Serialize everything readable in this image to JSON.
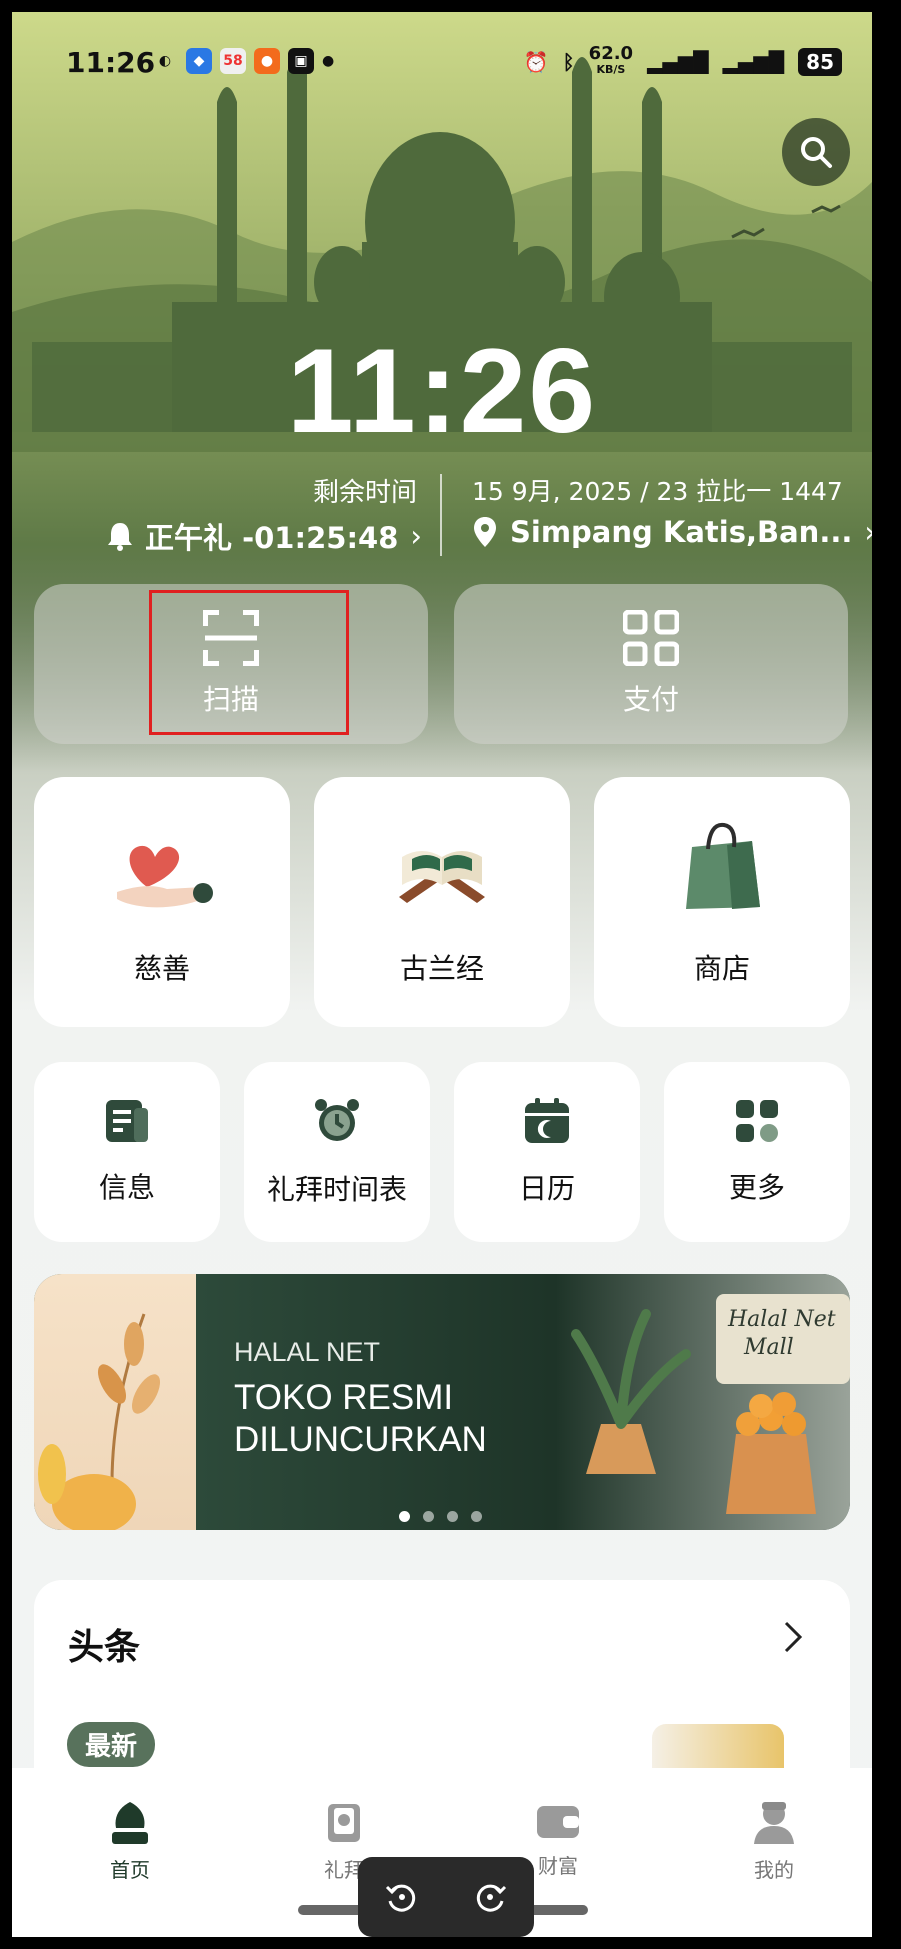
{
  "status_bar": {
    "time": "11:26",
    "apps": [
      "wechat",
      "map-app",
      "58",
      "video-app",
      "tv-app"
    ],
    "net_speed": "62.0",
    "net_unit": "KB/S",
    "battery": "85"
  },
  "hero": {
    "clock": "11:26",
    "remaining_label": "剩余时间",
    "prayer_name_countdown": "正午礼 -01:25:48",
    "date": "15 9月, 2025 / 23 拉比一 1447",
    "location": "Simpang Katis,Ban..."
  },
  "quick_actions": [
    {
      "label": "扫描",
      "icon": "scan-icon"
    },
    {
      "label": "支付",
      "icon": "qr-pay-icon"
    }
  ],
  "features_large": [
    {
      "label": "慈善",
      "icon": "charity-heart-icon"
    },
    {
      "label": "古兰经",
      "icon": "quran-icon"
    },
    {
      "label": "商店",
      "icon": "shopping-bag-icon"
    }
  ],
  "features_small": [
    {
      "label": "信息",
      "icon": "info-icon"
    },
    {
      "label": "礼拜时间表",
      "icon": "alarm-clock-icon"
    },
    {
      "label": "日历",
      "icon": "calendar-icon"
    },
    {
      "label": "更多",
      "icon": "more-grid-icon"
    }
  ],
  "banner": {
    "subtitle": "HALAL NET",
    "title": "TOKO RESMI DILUNCURKAN",
    "sign_text": "Halal Net Mall",
    "slide_count": 4,
    "active_slide": 1
  },
  "news": {
    "title": "头条",
    "badge": "最新"
  },
  "tabbar": [
    {
      "label": "首页",
      "icon": "mosque-home-icon",
      "active": true
    },
    {
      "label": "礼拜",
      "icon": "prayer-book-icon",
      "active": false
    },
    {
      "label": "财富",
      "icon": "wallet-icon",
      "active": false
    },
    {
      "label": "我的",
      "icon": "profile-icon",
      "active": false
    }
  ],
  "colors": {
    "accent": "#2f4a3b",
    "highlight_box": "#e02020"
  }
}
